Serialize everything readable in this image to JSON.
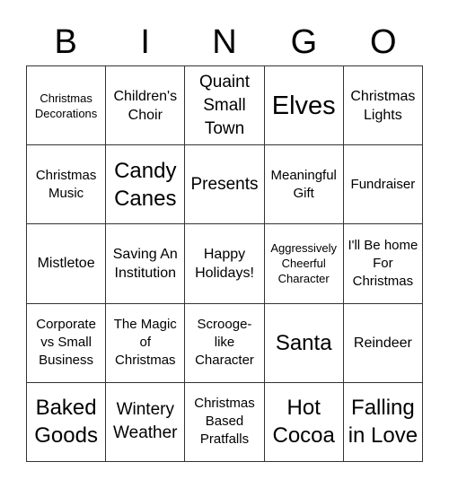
{
  "header": {
    "letters": [
      "B",
      "I",
      "N",
      "G",
      "O"
    ]
  },
  "cells": [
    [
      "Christmas Decorations",
      "Children's Choir",
      "Quaint Small Town",
      "Elves",
      "Christmas Lights"
    ],
    [
      "Christmas Music",
      "Candy Canes",
      "Presents",
      "Meaningful Gift",
      "Fundraiser"
    ],
    [
      "Mistletoe",
      "Saving An Institution",
      "Happy Holidays!",
      "Aggressively Cheerful Character",
      "I'll Be home For Christmas"
    ],
    [
      "Corporate vs Small Business",
      "The Magic of Christmas",
      "Scrooge-like Character",
      "Santa",
      "Reindeer"
    ],
    [
      "Baked Goods",
      "Wintery Weather",
      "Christmas Based Pratfalls",
      "Hot Cocoa",
      "Falling in Love"
    ]
  ]
}
